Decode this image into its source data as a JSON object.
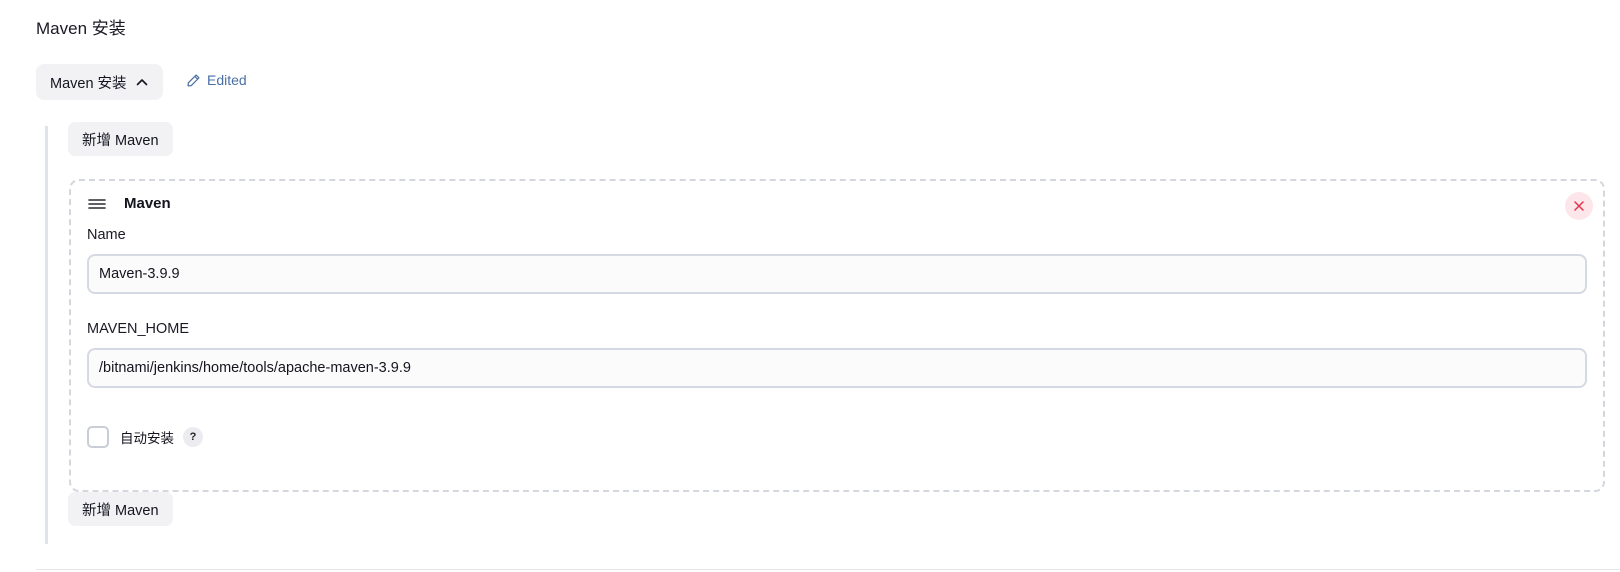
{
  "section": {
    "title": "Maven 安装"
  },
  "toggle": {
    "label": "Maven 安装",
    "edited_label": "Edited"
  },
  "add_button_top": {
    "label": "新增 Maven"
  },
  "add_button_bottom": {
    "label": "新增 Maven"
  },
  "card": {
    "title": "Maven",
    "name_label": "Name",
    "name_value": "Maven-3.9.9",
    "home_label": "MAVEN_HOME",
    "home_value": "/bitnami/jenkins/home/tools/apache-maven-3.9.9",
    "auto_install_label": "自动安装",
    "auto_install_checked": false,
    "help_label": "?"
  },
  "colors": {
    "accent_link": "#4a6fa5",
    "close_bg": "#fde6ea",
    "close_icon": "#e0334f",
    "button_bg": "#f2f2f5"
  },
  "icons": [
    "chevron-up-icon",
    "pencil-icon",
    "drag-handle-icon",
    "close-icon",
    "help-icon"
  ]
}
